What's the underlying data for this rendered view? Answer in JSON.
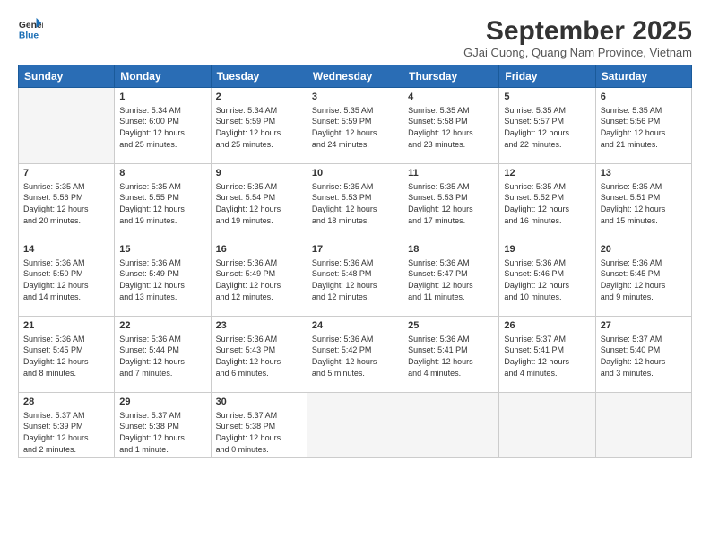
{
  "header": {
    "logo_line1": "General",
    "logo_line2": "Blue",
    "month_title": "September 2025",
    "location": "GJai Cuong, Quang Nam Province, Vietnam"
  },
  "days_of_week": [
    "Sunday",
    "Monday",
    "Tuesday",
    "Wednesday",
    "Thursday",
    "Friday",
    "Saturday"
  ],
  "weeks": [
    [
      {
        "day": "",
        "info": ""
      },
      {
        "day": "1",
        "info": "Sunrise: 5:34 AM\nSunset: 6:00 PM\nDaylight: 12 hours\nand 25 minutes."
      },
      {
        "day": "2",
        "info": "Sunrise: 5:34 AM\nSunset: 5:59 PM\nDaylight: 12 hours\nand 25 minutes."
      },
      {
        "day": "3",
        "info": "Sunrise: 5:35 AM\nSunset: 5:59 PM\nDaylight: 12 hours\nand 24 minutes."
      },
      {
        "day": "4",
        "info": "Sunrise: 5:35 AM\nSunset: 5:58 PM\nDaylight: 12 hours\nand 23 minutes."
      },
      {
        "day": "5",
        "info": "Sunrise: 5:35 AM\nSunset: 5:57 PM\nDaylight: 12 hours\nand 22 minutes."
      },
      {
        "day": "6",
        "info": "Sunrise: 5:35 AM\nSunset: 5:56 PM\nDaylight: 12 hours\nand 21 minutes."
      }
    ],
    [
      {
        "day": "7",
        "info": "Sunrise: 5:35 AM\nSunset: 5:56 PM\nDaylight: 12 hours\nand 20 minutes."
      },
      {
        "day": "8",
        "info": "Sunrise: 5:35 AM\nSunset: 5:55 PM\nDaylight: 12 hours\nand 19 minutes."
      },
      {
        "day": "9",
        "info": "Sunrise: 5:35 AM\nSunset: 5:54 PM\nDaylight: 12 hours\nand 19 minutes."
      },
      {
        "day": "10",
        "info": "Sunrise: 5:35 AM\nSunset: 5:53 PM\nDaylight: 12 hours\nand 18 minutes."
      },
      {
        "day": "11",
        "info": "Sunrise: 5:35 AM\nSunset: 5:53 PM\nDaylight: 12 hours\nand 17 minutes."
      },
      {
        "day": "12",
        "info": "Sunrise: 5:35 AM\nSunset: 5:52 PM\nDaylight: 12 hours\nand 16 minutes."
      },
      {
        "day": "13",
        "info": "Sunrise: 5:35 AM\nSunset: 5:51 PM\nDaylight: 12 hours\nand 15 minutes."
      }
    ],
    [
      {
        "day": "14",
        "info": "Sunrise: 5:36 AM\nSunset: 5:50 PM\nDaylight: 12 hours\nand 14 minutes."
      },
      {
        "day": "15",
        "info": "Sunrise: 5:36 AM\nSunset: 5:49 PM\nDaylight: 12 hours\nand 13 minutes."
      },
      {
        "day": "16",
        "info": "Sunrise: 5:36 AM\nSunset: 5:49 PM\nDaylight: 12 hours\nand 12 minutes."
      },
      {
        "day": "17",
        "info": "Sunrise: 5:36 AM\nSunset: 5:48 PM\nDaylight: 12 hours\nand 12 minutes."
      },
      {
        "day": "18",
        "info": "Sunrise: 5:36 AM\nSunset: 5:47 PM\nDaylight: 12 hours\nand 11 minutes."
      },
      {
        "day": "19",
        "info": "Sunrise: 5:36 AM\nSunset: 5:46 PM\nDaylight: 12 hours\nand 10 minutes."
      },
      {
        "day": "20",
        "info": "Sunrise: 5:36 AM\nSunset: 5:45 PM\nDaylight: 12 hours\nand 9 minutes."
      }
    ],
    [
      {
        "day": "21",
        "info": "Sunrise: 5:36 AM\nSunset: 5:45 PM\nDaylight: 12 hours\nand 8 minutes."
      },
      {
        "day": "22",
        "info": "Sunrise: 5:36 AM\nSunset: 5:44 PM\nDaylight: 12 hours\nand 7 minutes."
      },
      {
        "day": "23",
        "info": "Sunrise: 5:36 AM\nSunset: 5:43 PM\nDaylight: 12 hours\nand 6 minutes."
      },
      {
        "day": "24",
        "info": "Sunrise: 5:36 AM\nSunset: 5:42 PM\nDaylight: 12 hours\nand 5 minutes."
      },
      {
        "day": "25",
        "info": "Sunrise: 5:36 AM\nSunset: 5:41 PM\nDaylight: 12 hours\nand 4 minutes."
      },
      {
        "day": "26",
        "info": "Sunrise: 5:37 AM\nSunset: 5:41 PM\nDaylight: 12 hours\nand 4 minutes."
      },
      {
        "day": "27",
        "info": "Sunrise: 5:37 AM\nSunset: 5:40 PM\nDaylight: 12 hours\nand 3 minutes."
      }
    ],
    [
      {
        "day": "28",
        "info": "Sunrise: 5:37 AM\nSunset: 5:39 PM\nDaylight: 12 hours\nand 2 minutes."
      },
      {
        "day": "29",
        "info": "Sunrise: 5:37 AM\nSunset: 5:38 PM\nDaylight: 12 hours\nand 1 minute."
      },
      {
        "day": "30",
        "info": "Sunrise: 5:37 AM\nSunset: 5:38 PM\nDaylight: 12 hours\nand 0 minutes."
      },
      {
        "day": "",
        "info": ""
      },
      {
        "day": "",
        "info": ""
      },
      {
        "day": "",
        "info": ""
      },
      {
        "day": "",
        "info": ""
      }
    ]
  ]
}
